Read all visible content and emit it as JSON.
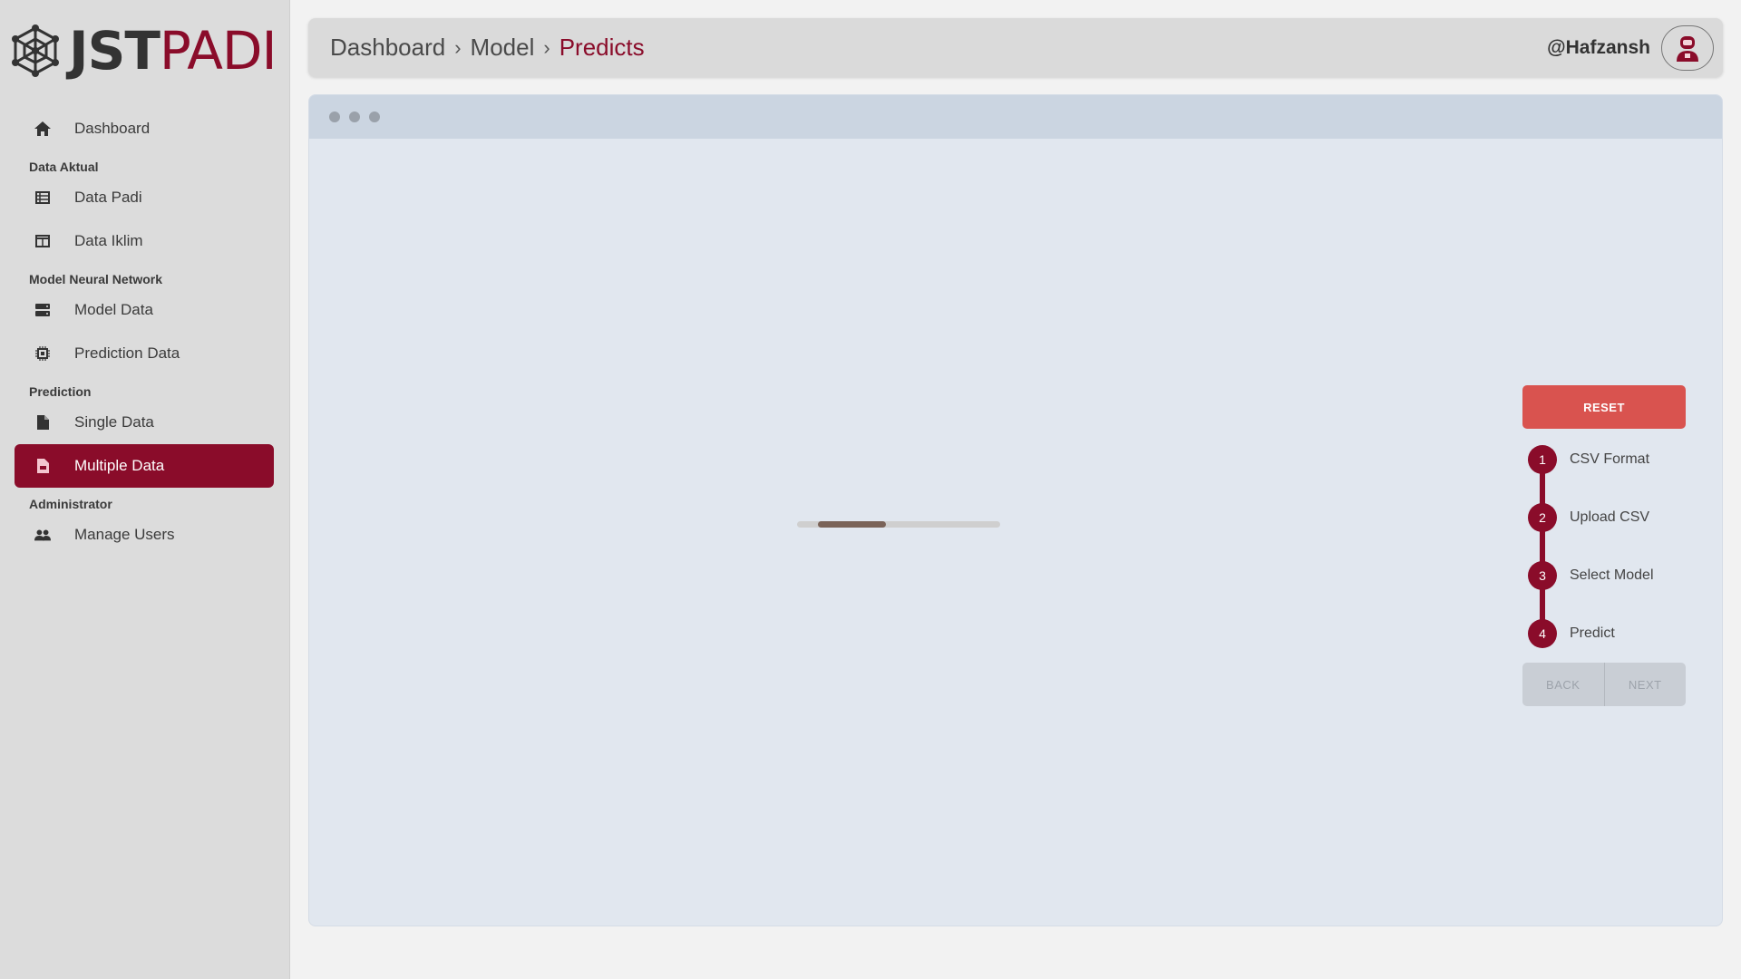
{
  "brand": {
    "part1": "JST",
    "part2": "PADI",
    "accent": "#8a0c2a"
  },
  "sidebar": {
    "items": [
      {
        "type": "item",
        "label": "Dashboard",
        "icon": "home-icon"
      },
      {
        "type": "section",
        "label": "Data Aktual"
      },
      {
        "type": "item",
        "label": "Data Padi",
        "icon": "table-icon"
      },
      {
        "type": "item",
        "label": "Data Iklim",
        "icon": "columns-icon"
      },
      {
        "type": "section",
        "label": "Model Neural Network"
      },
      {
        "type": "item",
        "label": "Model Data",
        "icon": "server-icon"
      },
      {
        "type": "item",
        "label": "Prediction Data",
        "icon": "chip-icon"
      },
      {
        "type": "section",
        "label": "Prediction"
      },
      {
        "type": "item",
        "label": "Single Data",
        "icon": "file-icon"
      },
      {
        "type": "item",
        "label": "Multiple Data",
        "icon": "csv-file-icon",
        "active": true
      },
      {
        "type": "section",
        "label": "Administrator"
      },
      {
        "type": "item",
        "label": "Manage Users",
        "icon": "users-icon"
      }
    ]
  },
  "header": {
    "breadcrumb": [
      "Dashboard",
      "Model",
      "Predicts"
    ],
    "username": "@Hafzansh"
  },
  "main": {
    "reset_label": "RESET",
    "steps": [
      {
        "num": "1",
        "label": "CSV Format"
      },
      {
        "num": "2",
        "label": "Upload CSV"
      },
      {
        "num": "3",
        "label": "Select Model"
      },
      {
        "num": "4",
        "label": "Predict"
      }
    ],
    "back_label": "BACK",
    "next_label": "NEXT"
  }
}
